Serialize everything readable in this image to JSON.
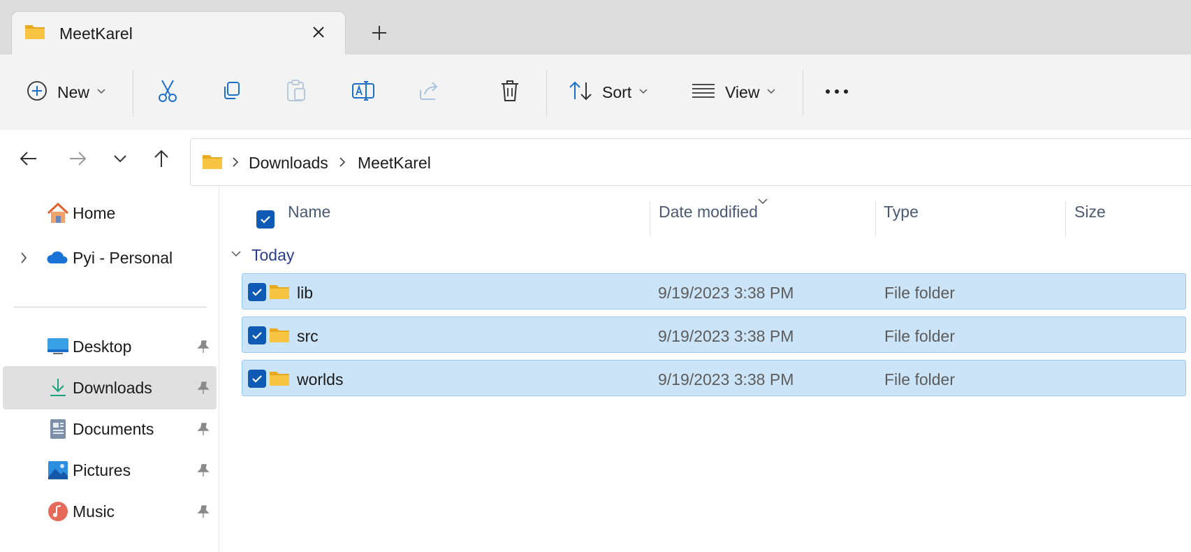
{
  "tab": {
    "title": "MeetKarel"
  },
  "toolbar": {
    "new_label": "New",
    "sort_label": "Sort",
    "view_label": "View"
  },
  "address": {
    "crumbs": [
      "Downloads",
      "MeetKarel"
    ]
  },
  "sidebar": {
    "items": [
      {
        "label": "Home",
        "icon": "home-icon"
      },
      {
        "label": "Pyi - Personal",
        "icon": "onedrive-cloud-icon"
      },
      {
        "label": "Desktop",
        "icon": "desktop-icon",
        "pinned": true
      },
      {
        "label": "Downloads",
        "icon": "download-arrow-icon",
        "pinned": true,
        "selected": true
      },
      {
        "label": "Documents",
        "icon": "documents-icon",
        "pinned": true
      },
      {
        "label": "Pictures",
        "icon": "pictures-icon",
        "pinned": true
      },
      {
        "label": "Music",
        "icon": "music-icon",
        "pinned": true
      }
    ]
  },
  "columns": {
    "name": "Name",
    "date_modified": "Date modified",
    "type": "Type",
    "size": "Size"
  },
  "group": {
    "label": "Today"
  },
  "files": [
    {
      "name": "lib",
      "date": "9/19/2023 3:38 PM",
      "type": "File folder",
      "selected": true
    },
    {
      "name": "src",
      "date": "9/19/2023 3:38 PM",
      "type": "File folder",
      "selected": true
    },
    {
      "name": "worlds",
      "date": "9/19/2023 3:38 PM",
      "type": "File folder",
      "selected": true
    }
  ],
  "colors": {
    "accent": "#0f5ab4",
    "selection_bg": "#cce4f7",
    "selection_border": "#99c9ef",
    "folder_yellow": "#f8c542"
  }
}
